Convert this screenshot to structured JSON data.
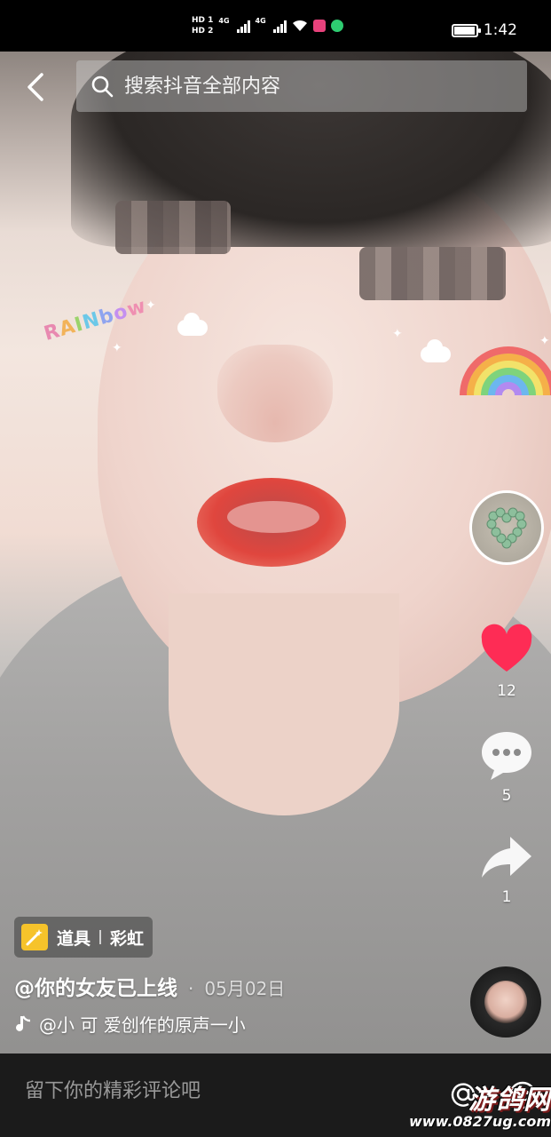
{
  "status_bar": {
    "hd1": "HD 1",
    "hd2": "HD 2",
    "net1": "4G",
    "net2": "4G",
    "time": "1:42"
  },
  "top_bar": {
    "search_placeholder": "搜索抖音全部内容",
    "back_icon": "chevron-left-icon",
    "search_icon": "search-icon"
  },
  "sticker": {
    "word_letters": [
      "R",
      "A",
      "I",
      "N",
      "b",
      "o",
      "w"
    ]
  },
  "actions": {
    "like_count": "12",
    "comment_count": "5",
    "share_count": "1",
    "like_color": "#fe2c55"
  },
  "video_info": {
    "prop_label": "道具",
    "prop_name": "彩虹",
    "author": "@你的女友已上线",
    "separator": "·",
    "date": "05月02日",
    "sound": "@小 可 爱创作的原声一小"
  },
  "comment_bar": {
    "placeholder": "留下你的精彩评论吧"
  },
  "watermark": {
    "title": "游鸽网",
    "url": "www.0827ug.com"
  }
}
